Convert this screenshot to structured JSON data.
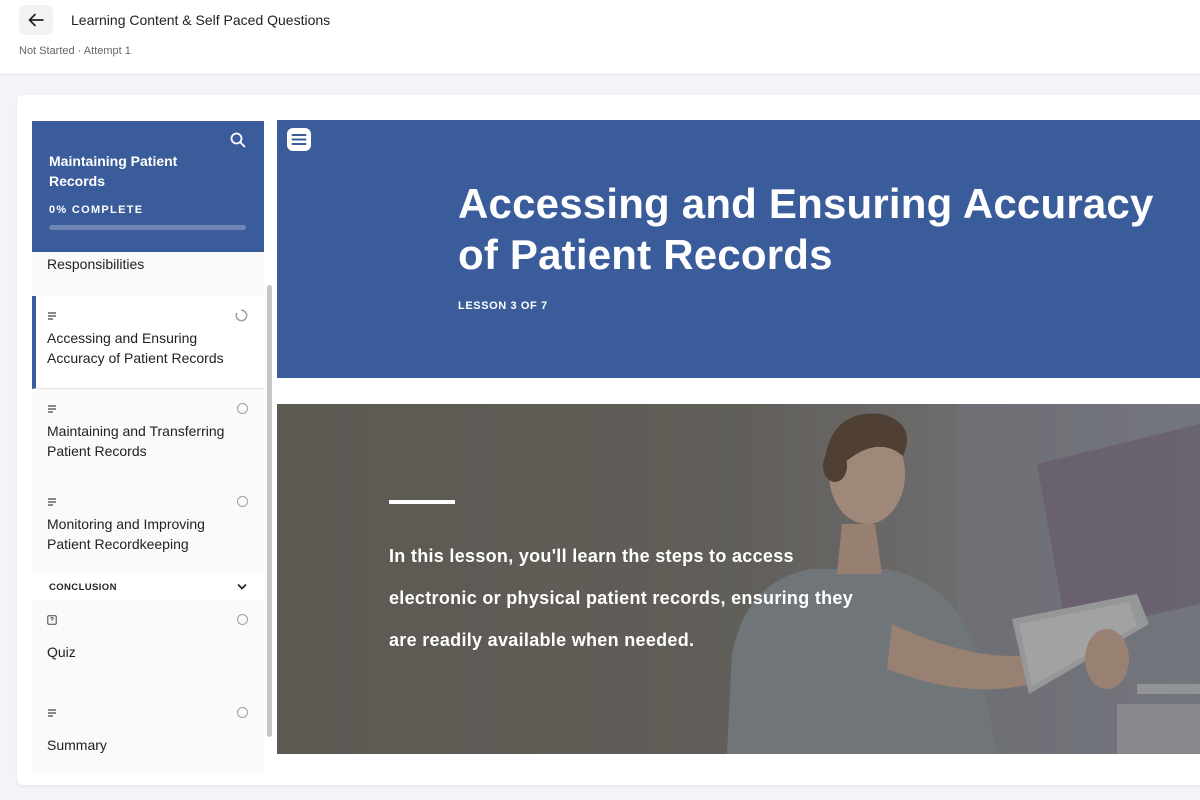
{
  "header": {
    "title": "Learning Content & Self Paced Questions",
    "status": "Not Started · Attempt 1"
  },
  "sidebar": {
    "course_title": "Maintaining Patient Records",
    "progress_label": "0% COMPLETE",
    "progress_value": 0,
    "items": [
      {
        "label": "Responsibilities",
        "icon": "text-lines-icon",
        "active": false
      },
      {
        "label": "Accessing and Ensuring Accuracy of Patient Records",
        "icon": "text-lines-icon",
        "active": true,
        "status": "in-progress"
      },
      {
        "label": "Maintaining and Transferring Patient Records",
        "icon": "text-lines-icon",
        "active": false,
        "status": "not-started"
      },
      {
        "label": "Monitoring and Improving Patient Recordkeeping",
        "icon": "text-lines-icon",
        "active": false,
        "status": "not-started"
      }
    ],
    "section": {
      "label": "CONCLUSION",
      "icon": "chevron-down-icon"
    },
    "section_items": [
      {
        "label": "Quiz",
        "icon": "quiz-icon",
        "status": "not-started"
      },
      {
        "label": "Summary",
        "icon": "text-lines-icon",
        "status": "not-started"
      }
    ]
  },
  "lesson": {
    "title": "Accessing and Ensuring Accuracy of Patient Records",
    "counter": "LESSON 3 OF 7",
    "intro": "In this lesson, you'll learn the steps to access electronic or physical patient records, ensuring they are readily available when needed."
  },
  "colors": {
    "brand_blue": "#3b5c9b",
    "page_bg": "#f3f4f7"
  }
}
